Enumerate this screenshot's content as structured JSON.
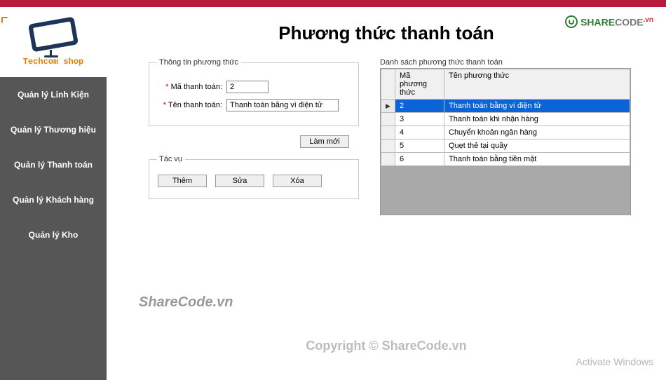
{
  "brand": {
    "name": "Techcom shop"
  },
  "sidebar": {
    "items": [
      {
        "label": "Quản lý Linh Kiện"
      },
      {
        "label": "Quản lý Thương hiệu"
      },
      {
        "label": "Quản lý Thanh toán"
      },
      {
        "label": "Quản lý Khách hàng"
      },
      {
        "label": "Quản lý Kho"
      }
    ]
  },
  "page": {
    "title": "Phương thức thanh toán"
  },
  "info_group": {
    "legend": "Thông tin phương thức",
    "code_label": "Mã thanh toán:",
    "code_value": "2",
    "name_label": "Tên thanh toán:",
    "name_value": "Thanh toán bằng ví điện tử"
  },
  "refresh_label": "Làm mới",
  "actions_group": {
    "legend": "Tác vụ",
    "add": "Thêm",
    "edit": "Sửa",
    "delete": "Xóa"
  },
  "list": {
    "header": "Danh sách phương thức thanh toán",
    "columns": {
      "code": "Mã phương thức",
      "name": "Tên phương thức"
    },
    "rows": [
      {
        "code": "2",
        "name": "Thanh toán bằng ví điện tử",
        "selected": true
      },
      {
        "code": "3",
        "name": "Thanh toán khi nhận hàng",
        "selected": false
      },
      {
        "code": "4",
        "name": "Chuyển khoản ngân hàng",
        "selected": false
      },
      {
        "code": "5",
        "name": "Quẹt thẻ tại quầy",
        "selected": false
      },
      {
        "code": "6",
        "name": "Thanh toán bằng tiền mặt",
        "selected": false
      }
    ]
  },
  "watermarks": {
    "wm1": "ShareCode.vn",
    "wm2": "Copyright © ShareCode.vn",
    "activate": "Activate Windows"
  },
  "logo": {
    "share": "SHARE",
    "code": "CODE",
    "vn": ".vn"
  }
}
